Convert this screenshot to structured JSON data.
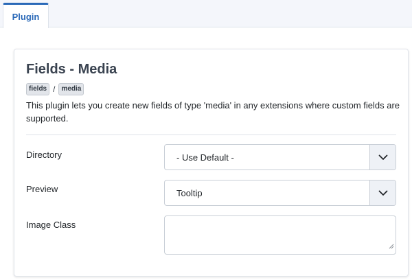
{
  "tabs": [
    {
      "label": "Plugin",
      "active": true
    }
  ],
  "plugin": {
    "title": "Fields - Media",
    "tags": [
      "fields",
      "media"
    ],
    "tag_separator": "/",
    "description": "This plugin lets you create new fields of type 'media' in any extensions where custom fields are supported."
  },
  "form": {
    "directory": {
      "label": "Directory",
      "value": "- Use Default -"
    },
    "preview": {
      "label": "Preview",
      "value": "Tooltip"
    },
    "image_class": {
      "label": "Image Class",
      "value": ""
    }
  },
  "colors": {
    "accent": "#2a69b8",
    "tag_bg": "#e2e5ea",
    "arrow_bg": "#eef1f6"
  },
  "icons": {
    "select_arrow": "chevron-down-icon",
    "resize_handle": "resize-grip-icon"
  }
}
